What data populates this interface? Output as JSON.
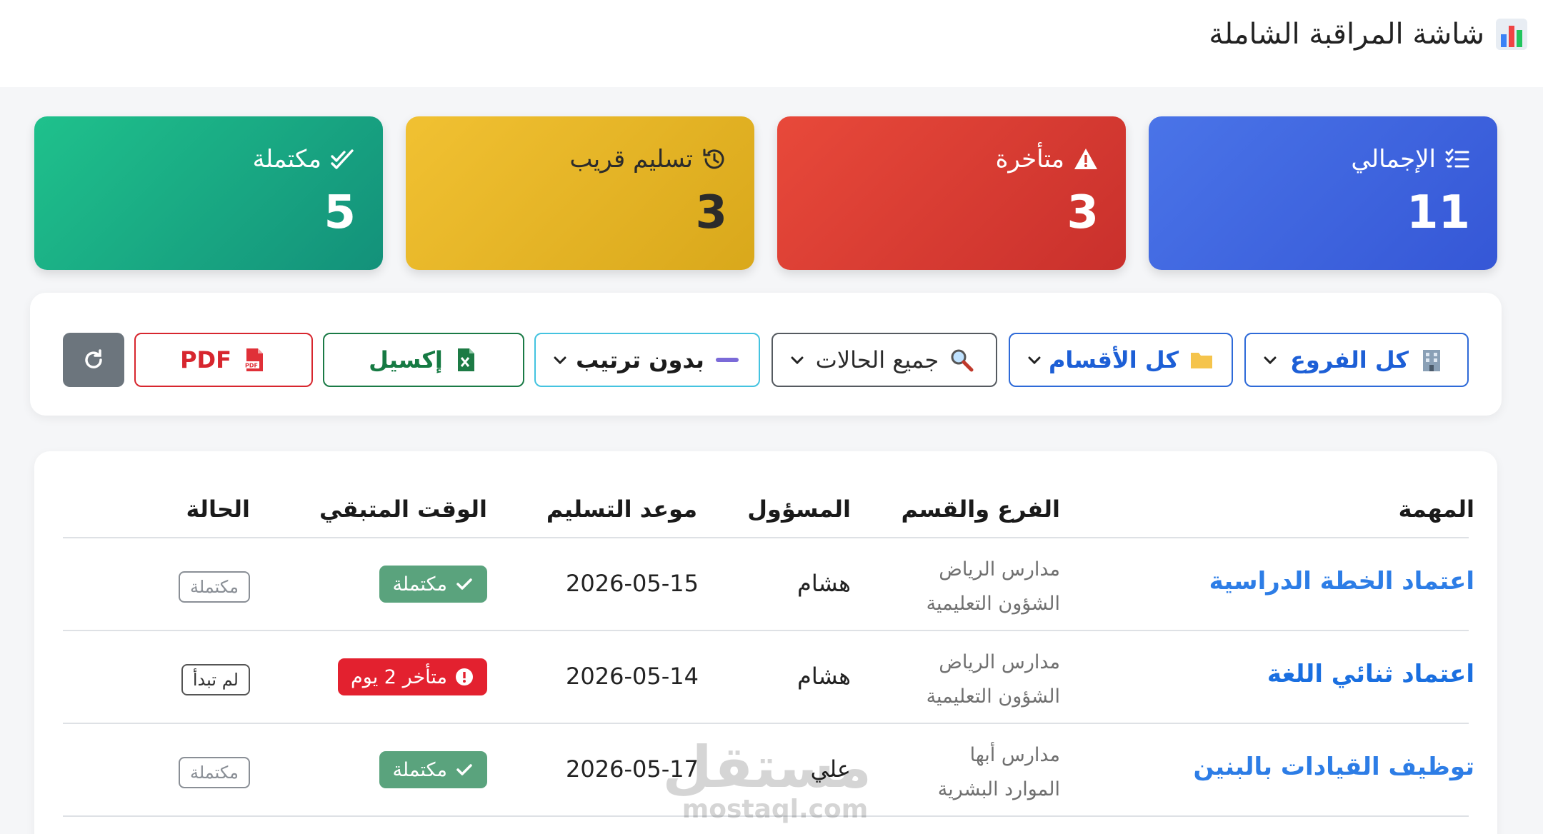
{
  "header": {
    "title": "شاشة المراقبة الشاملة",
    "icon": "bar-chart-icon"
  },
  "stats": {
    "total": {
      "label": "الإجمالي",
      "value": "11",
      "icon": "list-check-icon",
      "color": "#3e64df"
    },
    "late": {
      "label": "متأخرة",
      "value": "3",
      "icon": "warning-icon",
      "color": "#dd3e33"
    },
    "soon": {
      "label": "تسليم قريب",
      "value": "3",
      "icon": "history-icon",
      "color": "#e7b627"
    },
    "done": {
      "label": "مكتملة",
      "value": "5",
      "icon": "double-check-icon",
      "color": "#18a884"
    }
  },
  "filters": {
    "branch": "كل الفروع",
    "department": "كل الأقسام",
    "status": "جميع الحالات",
    "sort": "بدون ترتيب",
    "excel": "إكسيل",
    "pdf": "PDF"
  },
  "table": {
    "headers": {
      "task": "المهمة",
      "branch": "الفرع والقسم",
      "owner": "المسؤول",
      "due": "موعد التسليم",
      "remaining": "الوقت المتبقي",
      "status": "الحالة"
    },
    "rows": [
      {
        "task": "اعتماد الخطة الدراسية",
        "branch": "مدارس الرياض",
        "dept": "الشؤون التعليمية",
        "owner": "هشام",
        "due": "2026-05-15",
        "remaining": "مكتملة",
        "status": "مكتملة"
      },
      {
        "task": "اعتماد ثنائي اللغة",
        "branch": "مدارس الرياض",
        "dept": "الشؤون التعليمية",
        "owner": "هشام",
        "due": "2026-05-14",
        "remaining": "متأخر 2 يوم",
        "status": "لم تبدأ"
      },
      {
        "task": "توظيف القيادات بالبنين",
        "branch": "مدارس أبها",
        "dept": "الموارد البشرية",
        "owner": "علي",
        "due": "2026-05-17",
        "remaining": "مكتملة",
        "status": "مكتملة"
      }
    ]
  },
  "watermark": {
    "arabic": "مستقل",
    "latin": "mostaql.com"
  }
}
